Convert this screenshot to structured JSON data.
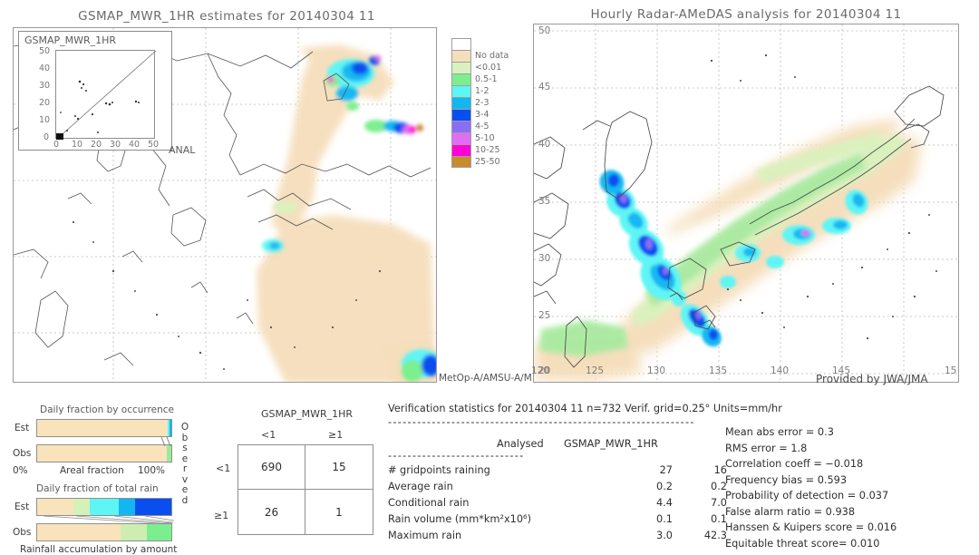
{
  "left_panel": {
    "title": "GSMAP_MWR_1HR estimates for 20140304 11",
    "inset": {
      "label": "GSMAP_MWR_1HR",
      "x_axis_label": "ANAL",
      "y_ticks": [
        "50",
        "40",
        "30",
        "20",
        "10",
        "0"
      ],
      "x_ticks": [
        "0",
        "10",
        "20",
        "30",
        "40",
        "50"
      ]
    },
    "corner_caption": "MetOp-A/AMSU-A/M",
    "corner_caption_tail": "20"
  },
  "right_panel": {
    "title": "Hourly Radar-AMeDAS analysis for 20140304 11",
    "credit": "Provided by JWA/JMA",
    "lat_ticks": [
      "50",
      "45",
      "40",
      "35",
      "30",
      "25",
      "20"
    ],
    "lon_ticks": [
      "120",
      "125",
      "130",
      "135",
      "140",
      "145",
      "15"
    ]
  },
  "colorbar": {
    "entries": [
      {
        "label": "",
        "color": "#ffffff"
      },
      {
        "label": "No data",
        "color": "#f5debb"
      },
      {
        "label": "<0.01",
        "color": "#d9f2bd"
      },
      {
        "label": "0.5-1",
        "color": "#7bef8f"
      },
      {
        "label": "1-2",
        "color": "#5ef5f5"
      },
      {
        "label": "2-3",
        "color": "#12b7f2"
      },
      {
        "label": "3-4",
        "color": "#0a4ef0"
      },
      {
        "label": "4-5",
        "color": "#8a6ef5"
      },
      {
        "label": "5-10",
        "color": "#df6ef0"
      },
      {
        "label": "10-25",
        "color": "#ff00d8"
      },
      {
        "label": "25-50",
        "color": "#c88b2e"
      }
    ]
  },
  "occurrence_chart": {
    "title": "Daily fraction by occurrence",
    "xlabel": "Areal fraction",
    "x_min_label": "0%",
    "x_max_label": "100%",
    "rows": [
      {
        "label": "Est",
        "segments": [
          {
            "color": "#f9e3ba",
            "pct": 97.6
          },
          {
            "color": "#5ef5f5",
            "pct": 1.2
          },
          {
            "color": "#12b7f2",
            "pct": 1.2
          }
        ]
      },
      {
        "label": "Obs",
        "segments": [
          {
            "color": "#f9e3ba",
            "pct": 96.3
          },
          {
            "color": "#9bea9b",
            "pct": 3.7
          }
        ]
      }
    ]
  },
  "amount_chart": {
    "title": "Daily fraction of total rain",
    "caption": "Rainfall accumulation by amount",
    "rows": [
      {
        "label": "Est",
        "segments": [
          {
            "color": "#f9e3ba",
            "pct": 27
          },
          {
            "color": "#d4f2b8",
            "pct": 12
          },
          {
            "color": "#5ef5f5",
            "pct": 22
          },
          {
            "color": "#12b7f2",
            "pct": 12
          },
          {
            "color": "#0a4ef0",
            "pct": 27
          }
        ]
      },
      {
        "label": "Obs",
        "segments": [
          {
            "color": "#f9e3ba",
            "pct": 62
          },
          {
            "color": "#cdeeb0",
            "pct": 20
          },
          {
            "color": "#7bef8f",
            "pct": 18
          }
        ]
      }
    ]
  },
  "contingency": {
    "title": "GSMAP_MWR_1HR",
    "col_headers": [
      "<1",
      "≥1"
    ],
    "row_headers": [
      "<1",
      "≥1"
    ],
    "observed_label": "Observed",
    "values": [
      [
        "690",
        "15"
      ],
      [
        "26",
        "1"
      ]
    ]
  },
  "verification": {
    "header": "Verification statistics for 20140304 11  n=732  Verif. grid=0.25°  Units=mm/hr",
    "rule": "---------------------------------------------------------------",
    "col_headers": [
      "Analysed",
      "GSMAP_MWR_1HR"
    ],
    "sub_rule": "----------------------------",
    "rows": [
      {
        "name": "# gridpoints raining",
        "analysed": "27",
        "model": "16"
      },
      {
        "name": "Average rain",
        "analysed": "0.2",
        "model": "0.2"
      },
      {
        "name": "Conditional rain",
        "analysed": "4.4",
        "model": "7.0"
      },
      {
        "name": "Rain volume (mm*km²x10⁶)",
        "analysed": "0.1",
        "model": "0.1"
      },
      {
        "name": "Maximum rain",
        "analysed": "3.0",
        "model": "42.3"
      }
    ],
    "scores": [
      "Mean abs error = 0.3",
      "RMS error = 1.8",
      "Correlation coeff = −0.018",
      "Frequency bias = 0.593",
      "Probability of detection = 0.037",
      "False alarm ratio = 0.938",
      "Hanssen & Kuipers score = 0.016",
      "Equitable threat score= 0.010"
    ]
  }
}
